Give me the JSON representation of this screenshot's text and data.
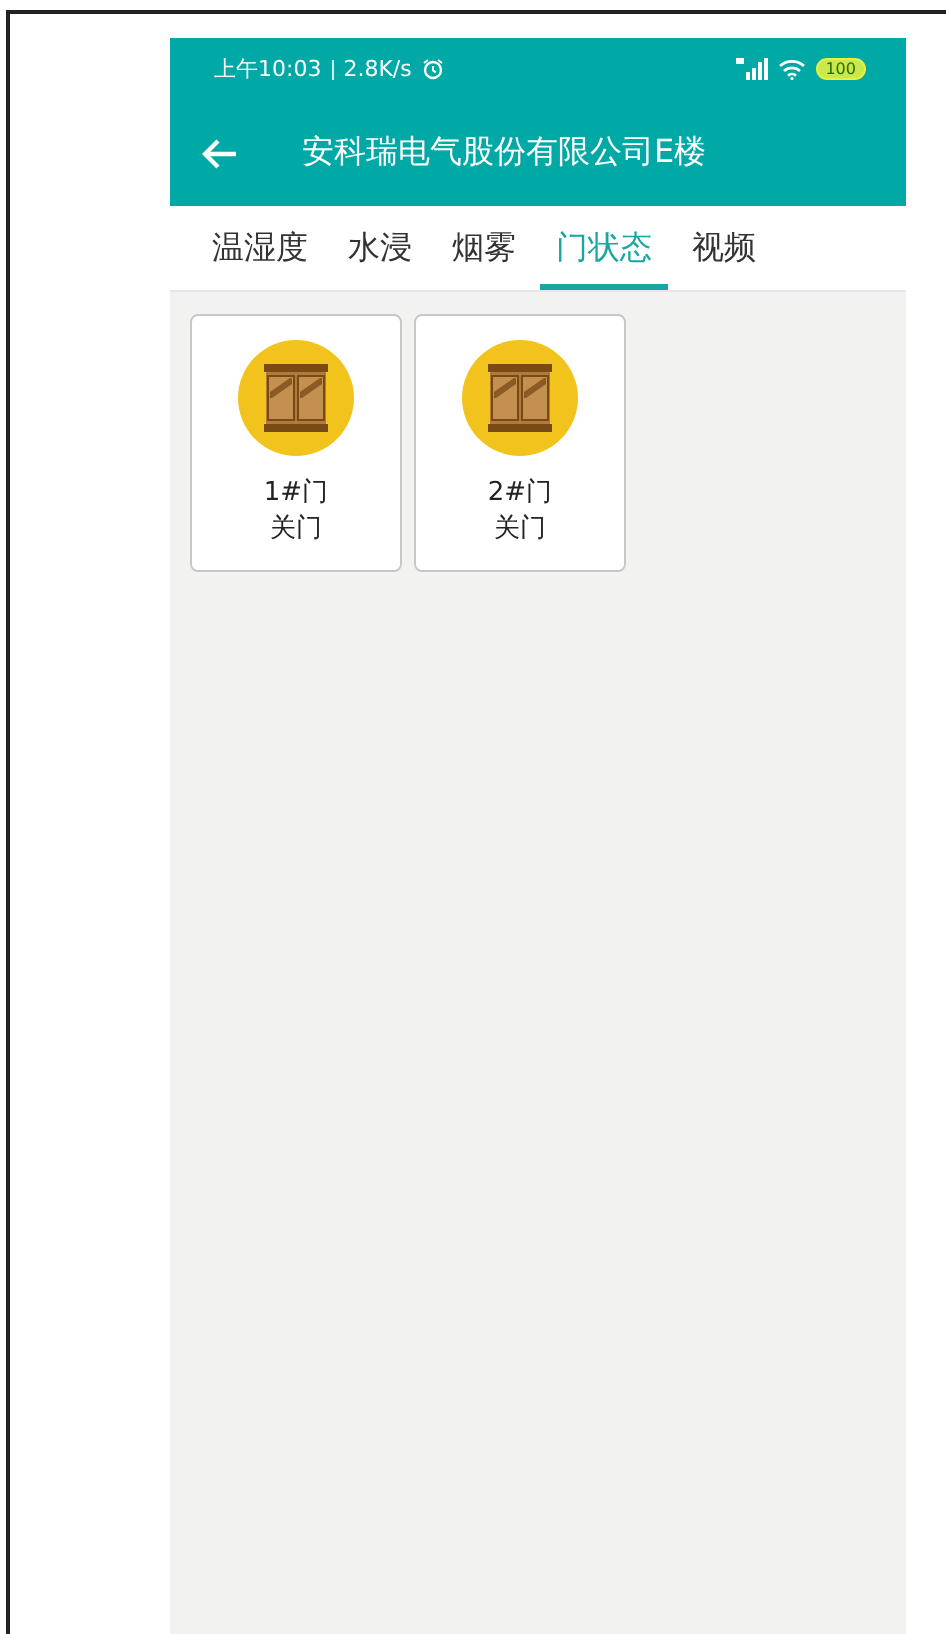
{
  "status_bar": {
    "time": "上午10:03",
    "speed": "2.8K/s",
    "battery": "100"
  },
  "header": {
    "title": "安科瑞电气股份有限公司E楼"
  },
  "tabs": [
    {
      "label": "温湿度",
      "selected": false
    },
    {
      "label": "水浸",
      "selected": false
    },
    {
      "label": "烟雾",
      "selected": false
    },
    {
      "label": "门状态",
      "selected": true
    },
    {
      "label": "视频",
      "selected": false
    }
  ],
  "doors": [
    {
      "name": "1#门",
      "status": "关门"
    },
    {
      "name": "2#门",
      "status": "关门"
    }
  ]
}
